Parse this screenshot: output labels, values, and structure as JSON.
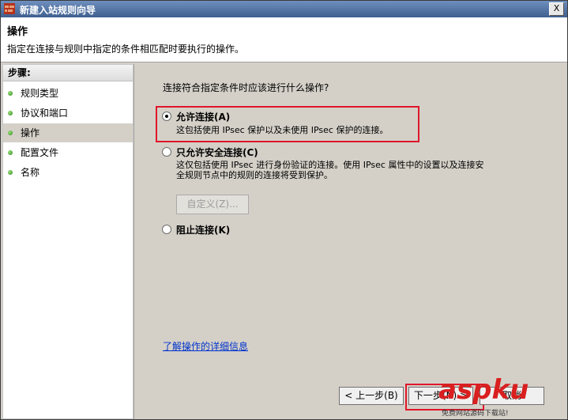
{
  "window": {
    "title": "新建入站规则向导",
    "close_label": "X"
  },
  "header": {
    "title": "操作",
    "description": "指定在连接与规则中指定的条件相匹配时要执行的操作。"
  },
  "steps": {
    "title": "步骤:",
    "items": [
      {
        "label": "规则类型"
      },
      {
        "label": "协议和端口"
      },
      {
        "label": "操作",
        "active": true
      },
      {
        "label": "配置文件"
      },
      {
        "label": "名称"
      }
    ]
  },
  "main": {
    "question": "连接符合指定条件时应该进行什么操作?",
    "options": [
      {
        "label": "允许连接(A)",
        "description": "这包括使用 IPsec 保护以及未使用 IPsec 保护的连接。",
        "selected": true
      },
      {
        "label": "只允许安全连接(C)",
        "description_line1": "这仅包括使用 IPsec 进行身份验证的连接。使用 IPsec 属性中的设置以及连接安",
        "description_line2": "全规则节点中的规则的连接将受到保护。",
        "selected": false
      },
      {
        "label": "阻止连接(K)",
        "selected": false
      }
    ],
    "customize_label": "自定义(Z)...",
    "learn_more": "了解操作的详细信息"
  },
  "footer": {
    "back_label": "< 上一步(B)",
    "next_label": "下一步(N) >",
    "cancel_label": "取消"
  },
  "watermark": {
    "brand": "aspku",
    "slogan": "免费网站源码下载站!"
  },
  "colors": {
    "title_bar": "#4a6a9a",
    "highlight": "#e0162b",
    "link": "#0033cc"
  }
}
